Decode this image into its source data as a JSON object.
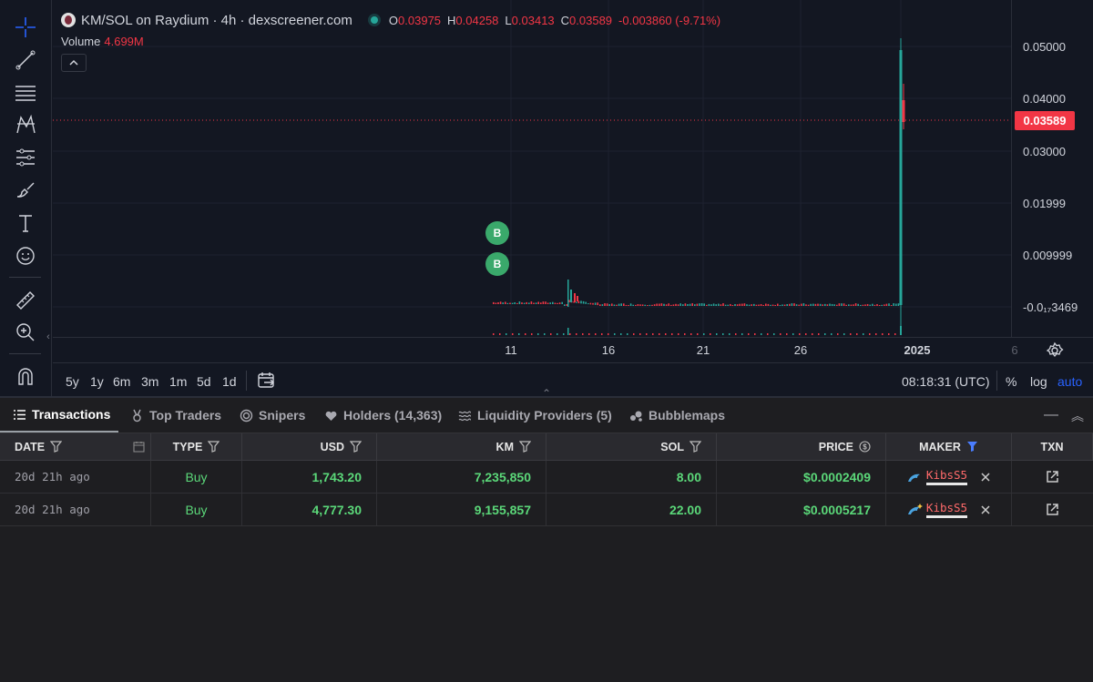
{
  "chart": {
    "pair_title": "KM/SOL on Raydium · 4h · dexscreener.com",
    "ohlc": [
      {
        "k": "O",
        "v": "0.03975"
      },
      {
        "k": "H",
        "v": "0.04258"
      },
      {
        "k": "L",
        "v": "0.03413"
      },
      {
        "k": "C",
        "v": "0.03589"
      }
    ],
    "change": "-0.003860 (-9.71%)",
    "volume_label": "Volume",
    "volume_value": "4.699M",
    "price_ticks": [
      "0.05000",
      "0.04000",
      "0.03000",
      "0.01999",
      "0.009999",
      "-0.0₁₇3469"
    ],
    "last_price": "0.03589",
    "time_ticks": [
      "11",
      "16",
      "21",
      "26",
      "2025",
      "6"
    ],
    "markers": [
      "B",
      "B"
    ],
    "ranges": [
      "5y",
      "1y",
      "6m",
      "3m",
      "1m",
      "5d",
      "1d"
    ],
    "clock": "08:18:31 (UTC)",
    "pct": "%",
    "log": "log",
    "auto": "auto",
    "colors": {
      "up": "#26a69a",
      "down": "#f23645",
      "bg": "#131722"
    }
  },
  "tabs": [
    {
      "label": "Transactions",
      "icon": "list-icon"
    },
    {
      "label": "Top Traders",
      "icon": "medal-icon"
    },
    {
      "label": "Snipers",
      "icon": "target-icon"
    },
    {
      "label": "Holders (14,363)",
      "icon": "heart-icon"
    },
    {
      "label": "Liquidity Providers (5)",
      "icon": "waves-icon"
    },
    {
      "label": "Bubblemaps",
      "icon": "bubbles-icon"
    }
  ],
  "table": {
    "headers": {
      "date": "DATE",
      "type": "TYPE",
      "usd": "USD",
      "km": "KM",
      "sol": "SOL",
      "price": "PRICE",
      "maker": "MAKER",
      "txn": "TXN"
    },
    "rows": [
      {
        "date": "20d 21h ago",
        "type": "Buy",
        "usd": "1,743.20",
        "km": "7,235,850",
        "sol": "8.00",
        "price": "$0.0002409",
        "maker": "KibsS5"
      },
      {
        "date": "20d 21h ago",
        "type": "Buy",
        "usd": "4,777.30",
        "km": "9,155,857",
        "sol": "22.00",
        "price": "$0.0005217",
        "maker": "KibsS5"
      }
    ]
  }
}
